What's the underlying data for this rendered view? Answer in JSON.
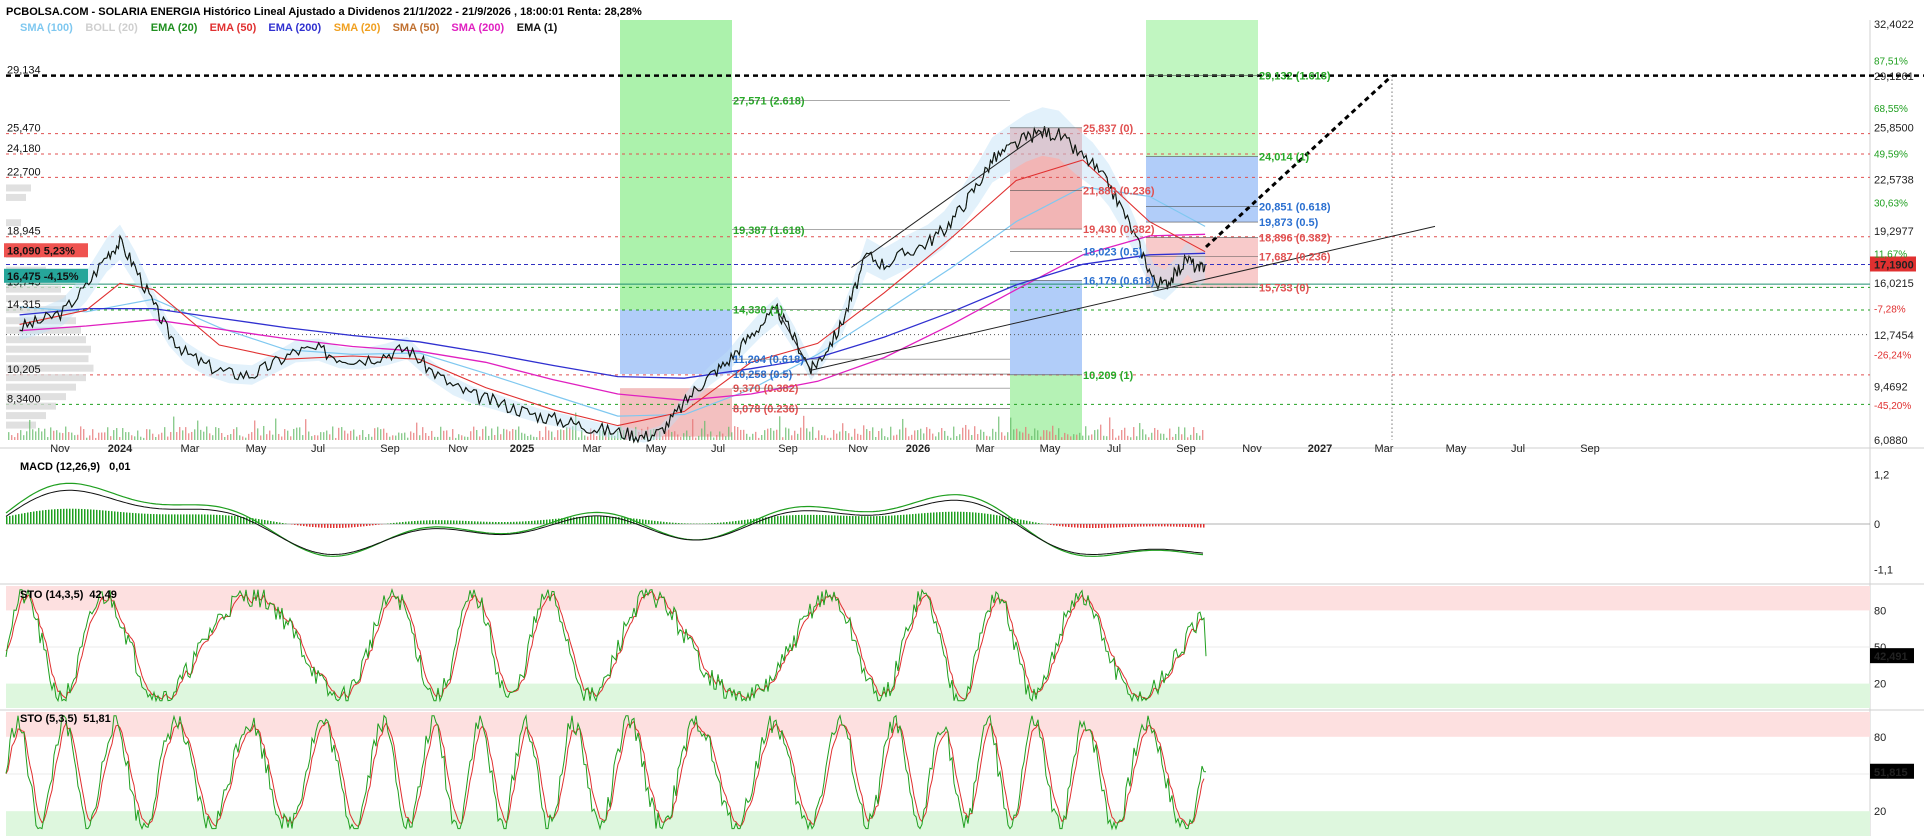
{
  "header": "PCBOLSA.COM - SOLARIA ENERGIA Histórico Lineal Ajustado a Dividenos 21/1/2022 - 21/9/2026 , 18:00:01 Renta: 28,28%",
  "legend": [
    {
      "label": "SMA (100)",
      "color": "#7fc8f0"
    },
    {
      "label": "BOLL (20)",
      "color": "#cfcfcf"
    },
    {
      "label": "EMA (20)",
      "color": "#1f8f1f"
    },
    {
      "label": "EMA (50)",
      "color": "#e03030"
    },
    {
      "label": "EMA (200)",
      "color": "#3030d0"
    },
    {
      "label": "SMA (20)",
      "color": "#f0a020"
    },
    {
      "label": "SMA (50)",
      "color": "#c07030"
    },
    {
      "label": "SMA (200)",
      "color": "#e020c0"
    },
    {
      "label": "EMA (1)",
      "color": "#111111"
    }
  ],
  "colors": {
    "up": "#1f9f1f",
    "down": "#e03030",
    "fib_green": "#28a828",
    "fib_red": "#e05050",
    "fib_blue": "#2a6fd0"
  },
  "chart_data": [
    {
      "type": "line",
      "name": "price",
      "x_labels": [
        "Nov",
        "2024",
        "Mar",
        "May",
        "Jul",
        "Sep",
        "Nov",
        "2025",
        "Mar",
        "May",
        "Jul",
        "Sep",
        "Nov",
        "2026",
        "Mar",
        "May",
        "Jul",
        "Sep",
        "Nov",
        "2027",
        "Mar",
        "May",
        "Jul",
        "Sep"
      ],
      "y_axis_labels": [
        "32,4022",
        "29,1261",
        "25,8500",
        "22,5738",
        "19,2977",
        "17,1900",
        "16,0215",
        "12,7454",
        "9,4692",
        "6,0880"
      ],
      "y_axis_pcts": [
        "87,51%",
        "68,55%",
        "49,59%",
        "30,63%",
        "11,67%",
        "-7,28%",
        "-26,24%",
        "-45,20%"
      ],
      "ylim": [
        6.088,
        32.4022
      ],
      "last_price": 17.19,
      "left_levels": [
        "29,134",
        "25,470",
        "24,180",
        "22,700",
        "18,945",
        "15,745",
        "14,315",
        "10,205",
        "8,3400"
      ],
      "left_badges": [
        {
          "text": "18,090  5,23%"
        },
        {
          "text": "16,475  -4,15%"
        }
      ],
      "close": [
        [
          "2023-10-01",
          13.2
        ],
        [
          "2023-10-20",
          13.6
        ],
        [
          "2023-11-10",
          14.2
        ],
        [
          "2023-12-01",
          15.8
        ],
        [
          "2023-12-20",
          17.8
        ],
        [
          "2024-01-01",
          18.6
        ],
        [
          "2024-01-15",
          17.0
        ],
        [
          "2024-02-01",
          14.6
        ],
        [
          "2024-02-15",
          12.8
        ],
        [
          "2024-03-01",
          11.6
        ],
        [
          "2024-03-20",
          10.8
        ],
        [
          "2024-04-10",
          10.3
        ],
        [
          "2024-05-01",
          10.2
        ],
        [
          "2024-05-20",
          10.9
        ],
        [
          "2024-06-10",
          11.7
        ],
        [
          "2024-07-01",
          11.8
        ],
        [
          "2024-07-20",
          11.3
        ],
        [
          "2024-08-10",
          11.2
        ],
        [
          "2024-09-01",
          11.5
        ],
        [
          "2024-09-20",
          11.9
        ],
        [
          "2024-10-10",
          10.6
        ],
        [
          "2024-11-01",
          9.5
        ],
        [
          "2024-11-20",
          8.9
        ],
        [
          "2024-12-10",
          8.5
        ],
        [
          "2025-01-01",
          8.0
        ],
        [
          "2025-01-20",
          7.6
        ],
        [
          "2025-02-10",
          7.3
        ],
        [
          "2025-03-01",
          7.0
        ],
        [
          "2025-03-20",
          6.7
        ],
        [
          "2025-04-10",
          6.5
        ],
        [
          "2025-04-25",
          6.3
        ],
        [
          "2025-05-10",
          6.6
        ],
        [
          "2025-05-25",
          7.8
        ],
        [
          "2025-06-10",
          9.2
        ],
        [
          "2025-06-25",
          10.2
        ],
        [
          "2025-07-10",
          11.0
        ],
        [
          "2025-07-25",
          12.2
        ],
        [
          "2025-08-10",
          13.4
        ],
        [
          "2025-08-25",
          14.3
        ],
        [
          "2025-09-10",
          12.5
        ],
        [
          "2025-09-25",
          10.5
        ],
        [
          "2025-10-05",
          11.4
        ],
        [
          "2025-10-20",
          13.0
        ],
        [
          "2025-11-01",
          15.0
        ],
        [
          "2025-11-15",
          17.8
        ],
        [
          "2025-12-01",
          17.2
        ],
        [
          "2025-12-20",
          17.9
        ],
        [
          "2026-01-10",
          18.6
        ],
        [
          "2026-01-25",
          19.4
        ],
        [
          "2026-02-10",
          20.8
        ],
        [
          "2026-02-25",
          22.3
        ],
        [
          "2026-03-10",
          23.8
        ],
        [
          "2026-03-25",
          24.5
        ],
        [
          "2026-04-10",
          25.2
        ],
        [
          "2026-04-25",
          25.6
        ],
        [
          "2026-05-10",
          25.4
        ],
        [
          "2026-05-25",
          24.4
        ],
        [
          "2026-06-10",
          23.5
        ],
        [
          "2026-06-25",
          22.2
        ],
        [
          "2026-07-10",
          20.3
        ],
        [
          "2026-07-25",
          18.0
        ],
        [
          "2026-08-05",
          16.2
        ],
        [
          "2026-08-15",
          15.9
        ],
        [
          "2026-08-25",
          16.6
        ],
        [
          "2026-09-05",
          17.6
        ],
        [
          "2026-09-15",
          16.8
        ],
        [
          "2026-09-21",
          17.19
        ]
      ],
      "sma200": [
        [
          "2023-10-01",
          13.0
        ],
        [
          "2023-12-01",
          13.3
        ],
        [
          "2024-02-01",
          13.7
        ],
        [
          "2024-04-01",
          13.1
        ],
        [
          "2024-06-01",
          12.5
        ],
        [
          "2024-08-01",
          12.0
        ],
        [
          "2024-10-01",
          11.7
        ],
        [
          "2024-12-01",
          11.0
        ],
        [
          "2025-02-01",
          9.9
        ],
        [
          "2025-04-01",
          9.0
        ],
        [
          "2025-06-01",
          8.6
        ],
        [
          "2025-08-01",
          9.0
        ],
        [
          "2025-10-01",
          9.8
        ],
        [
          "2025-12-01",
          11.3
        ],
        [
          "2026-02-01",
          13.4
        ],
        [
          "2026-04-01",
          15.6
        ],
        [
          "2026-06-01",
          17.8
        ],
        [
          "2026-08-01",
          19.0
        ],
        [
          "2026-09-21",
          19.1
        ]
      ],
      "ema200": [
        [
          "2023-10-01",
          14.0
        ],
        [
          "2023-12-01",
          14.4
        ],
        [
          "2024-02-01",
          14.4
        ],
        [
          "2024-04-01",
          13.8
        ],
        [
          "2024-06-01",
          13.2
        ],
        [
          "2024-08-01",
          12.7
        ],
        [
          "2024-10-01",
          12.3
        ],
        [
          "2024-12-01",
          11.6
        ],
        [
          "2025-02-01",
          10.8
        ],
        [
          "2025-04-01",
          10.1
        ],
        [
          "2025-06-01",
          10.0
        ],
        [
          "2025-08-01",
          10.6
        ],
        [
          "2025-10-01",
          11.3
        ],
        [
          "2025-12-01",
          12.6
        ],
        [
          "2026-02-01",
          14.2
        ],
        [
          "2026-04-01",
          15.9
        ],
        [
          "2026-06-01",
          17.2
        ],
        [
          "2026-08-01",
          17.8
        ],
        [
          "2026-09-21",
          17.9
        ]
      ],
      "sma100": [
        [
          "2023-10-01",
          14.5
        ],
        [
          "2023-12-01",
          14.2
        ],
        [
          "2024-02-01",
          15.0
        ],
        [
          "2024-04-01",
          13.2
        ],
        [
          "2024-06-01",
          11.8
        ],
        [
          "2024-08-01",
          11.5
        ],
        [
          "2024-10-01",
          11.6
        ],
        [
          "2024-12-01",
          10.3
        ],
        [
          "2025-02-01",
          8.9
        ],
        [
          "2025-04-01",
          7.6
        ],
        [
          "2025-06-01",
          7.7
        ],
        [
          "2025-08-01",
          9.3
        ],
        [
          "2025-10-01",
          11.5
        ],
        [
          "2025-12-01",
          14.2
        ],
        [
          "2026-02-01",
          17.0
        ],
        [
          "2026-04-01",
          19.9
        ],
        [
          "2026-06-01",
          22.1
        ],
        [
          "2026-08-01",
          21.5
        ],
        [
          "2026-09-21",
          19.6
        ]
      ],
      "ema50": [
        [
          "2023-10-01",
          13.4
        ],
        [
          "2023-12-01",
          14.3
        ],
        [
          "2024-01-01",
          16.0
        ],
        [
          "2024-02-01",
          15.6
        ],
        [
          "2024-04-01",
          12.1
        ],
        [
          "2024-06-01",
          11.2
        ],
        [
          "2024-08-01",
          11.4
        ],
        [
          "2024-10-01",
          11.2
        ],
        [
          "2024-12-01",
          9.4
        ],
        [
          "2025-02-01",
          8.0
        ],
        [
          "2025-04-01",
          7.0
        ],
        [
          "2025-06-01",
          7.9
        ],
        [
          "2025-08-01",
          11.0
        ],
        [
          "2025-10-01",
          12.2
        ],
        [
          "2025-12-01",
          15.4
        ],
        [
          "2026-02-01",
          18.9
        ],
        [
          "2026-04-01",
          22.5
        ],
        [
          "2026-06-01",
          23.8
        ],
        [
          "2026-08-01",
          19.9
        ],
        [
          "2026-09-21",
          18.0
        ]
      ]
    },
    {
      "type": "line",
      "name": "MACD (12,26,9)",
      "value_text": "0,01",
      "y_axis_labels": [
        "1,2",
        "0",
        "-1,1"
      ],
      "ylim": [
        -1.4,
        1.5
      ]
    },
    {
      "type": "line",
      "name": "STO (14,3,5)",
      "value_text": "42,49",
      "badge": "42,491",
      "last": 42.49,
      "y_axis_labels": [
        "80",
        "50",
        "20"
      ],
      "ylim": [
        0,
        100
      ]
    },
    {
      "type": "line",
      "name": "STO (5,3,5)",
      "value_text": "51,81",
      "badge": "51,815",
      "last": 51.81,
      "y_axis_labels": [
        "80",
        "20"
      ],
      "ylim": [
        0,
        100
      ]
    }
  ],
  "fib_labels": [
    {
      "text": "27,571 (2.618)",
      "c": "green"
    },
    {
      "text": "19,387 (1.618)",
      "c": "green"
    },
    {
      "text": "14,330 (1)",
      "c": "green"
    },
    {
      "text": "11,204 (0.618)",
      "c": "blue"
    },
    {
      "text": "10,258 (0.5)",
      "c": "blue"
    },
    {
      "text": "9,370 (0.382)",
      "c": "red"
    },
    {
      "text": "8,078 (0.236)",
      "c": "red"
    },
    {
      "text": "29,132 (1.618)",
      "c": "green"
    },
    {
      "text": "25,837 (0)",
      "c": "red"
    },
    {
      "text": "24,014 (1)",
      "c": "green"
    },
    {
      "text": "21,880 (0.236)",
      "c": "red"
    },
    {
      "text": "20,851 (0.618)",
      "c": "blue"
    },
    {
      "text": "19,873 (0.5)",
      "c": "blue"
    },
    {
      "text": "19,430 (0.382)",
      "c": "red"
    },
    {
      "text": "18,896 (0.382)",
      "c": "red"
    },
    {
      "text": "18,023 (0.5)",
      "c": "blue"
    },
    {
      "text": "17,687 (0.236)",
      "c": "red"
    },
    {
      "text": "16,179 (0.618)",
      "c": "blue"
    },
    {
      "text": "15,733 (0)",
      "c": "red"
    },
    {
      "text": "10,209 (1)",
      "c": "green"
    }
  ]
}
